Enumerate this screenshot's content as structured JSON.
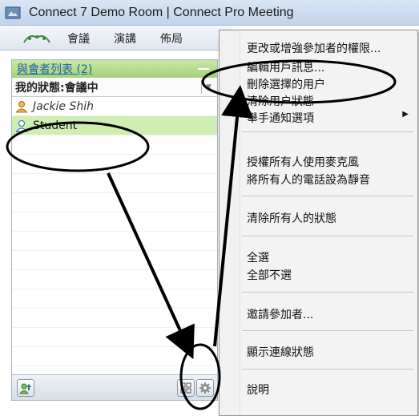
{
  "window": {
    "title": "Connect 7 Demo Room | Connect Pro Meeting"
  },
  "menubar": {
    "items": [
      "會議",
      "演講",
      "佈局"
    ]
  },
  "attendee_pod": {
    "title": "與會者列表 (2)",
    "my_status": "我的狀態:會議中",
    "users": [
      {
        "name": "Jackie Shih",
        "role": "host"
      },
      {
        "name": "Student",
        "role": "participant",
        "selected": true
      }
    ]
  },
  "context_menu": {
    "items": [
      "更改或增強參加者的權限...",
      "編輯用戶訊息...",
      "刪除選擇的用户",
      "清除用户狀態",
      "舉手通知選項",
      "授權所有人使用麥克風",
      "將所有人的電話設為靜音",
      "清除所有人的狀態",
      "全選",
      "全部不選",
      "邀請參加者...",
      "顯示連線狀態",
      "說明"
    ]
  },
  "colors": {
    "pod_header": "#a6d37a",
    "selected_row": "#cfeeb1",
    "annotation": "#000000"
  }
}
